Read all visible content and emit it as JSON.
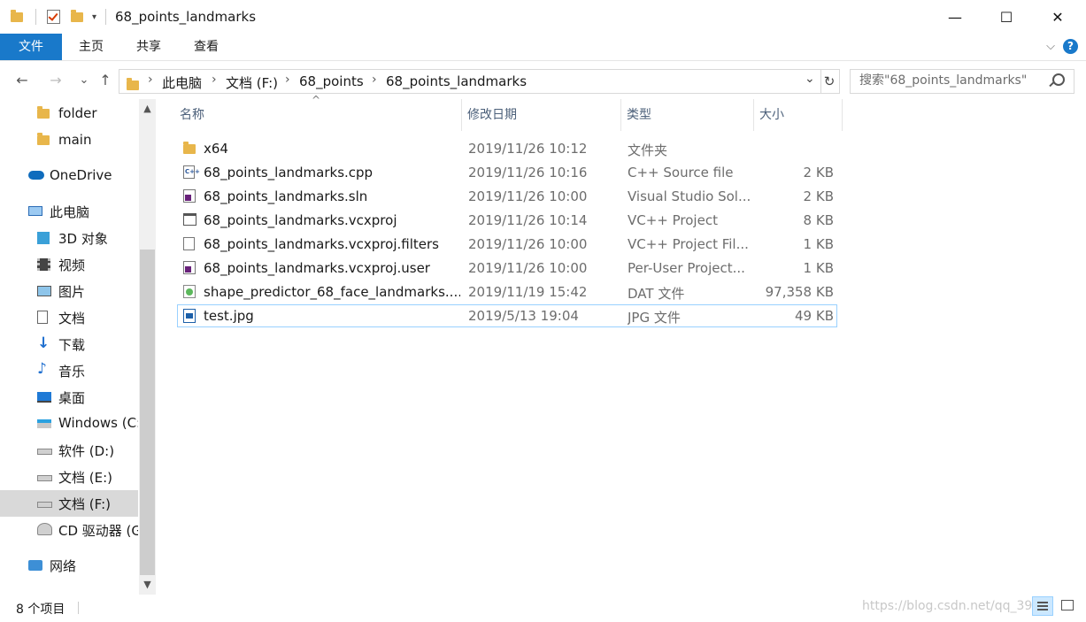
{
  "window": {
    "title": "68_points_landmarks",
    "minimize_glyph": "—",
    "maximize_glyph": "☐",
    "close_glyph": "✕"
  },
  "ribbon": {
    "tabs": [
      "文件",
      "主页",
      "共享",
      "查看"
    ],
    "expand_glyph": "⌵",
    "help_glyph": "?"
  },
  "nav": {
    "back_glyph": "←",
    "forward_glyph": "→",
    "recent_glyph": "⌄",
    "up_glyph": "↑",
    "breadcrumbs": [
      "此电脑",
      "文档 (F:)",
      "68_points",
      "68_points_landmarks"
    ],
    "crumb_separator": "›",
    "dropdown_glyph": "⌄",
    "refresh_glyph": "↻"
  },
  "search": {
    "placeholder": "搜索\"68_points_landmarks\""
  },
  "sidebar": {
    "items": [
      {
        "label": "folder",
        "icon": "folder-icon"
      },
      {
        "label": "main",
        "icon": "folder-icon"
      },
      {
        "label": "OneDrive",
        "icon": "cloud-icon"
      },
      {
        "label": "此电脑",
        "icon": "computer-icon"
      },
      {
        "label": "3D 对象",
        "icon": "cube-icon"
      },
      {
        "label": "视频",
        "icon": "video-icon"
      },
      {
        "label": "图片",
        "icon": "picture-icon"
      },
      {
        "label": "文档",
        "icon": "document-icon"
      },
      {
        "label": "下载",
        "icon": "download-icon"
      },
      {
        "label": "音乐",
        "icon": "music-icon"
      },
      {
        "label": "桌面",
        "icon": "desktop-icon"
      },
      {
        "label": "Windows (C:",
        "icon": "windows-drive-icon"
      },
      {
        "label": "软件 (D:)",
        "icon": "drive-icon"
      },
      {
        "label": "文档 (E:)",
        "icon": "drive-icon"
      },
      {
        "label": "文档 (F:)",
        "icon": "drive-icon"
      },
      {
        "label": "CD 驱动器 (G",
        "icon": "cd-drive-icon"
      },
      {
        "label": "网络",
        "icon": "network-icon"
      }
    ],
    "scroll_up_glyph": "▲",
    "scroll_down_glyph": "▼"
  },
  "columns": {
    "name": "名称",
    "date": "修改日期",
    "type": "类型",
    "size": "大小",
    "sort_glyph": "^"
  },
  "files": [
    {
      "name": "x64",
      "date": "2019/11/26 10:12",
      "type": "文件夹",
      "size": "",
      "icon": "folder-icon"
    },
    {
      "name": "68_points_landmarks.cpp",
      "date": "2019/11/26 10:16",
      "type": "C++ Source file",
      "size": "2 KB",
      "icon": "cpp-file-icon"
    },
    {
      "name": "68_points_landmarks.sln",
      "date": "2019/11/26 10:00",
      "type": "Visual Studio Sol...",
      "size": "2 KB",
      "icon": "vs-solution-icon"
    },
    {
      "name": "68_points_landmarks.vcxproj",
      "date": "2019/11/26 10:14",
      "type": "VC++ Project",
      "size": "8 KB",
      "icon": "vcxproj-icon"
    },
    {
      "name": "68_points_landmarks.vcxproj.filters",
      "date": "2019/11/26 10:00",
      "type": "VC++ Project Fil...",
      "size": "1 KB",
      "icon": "filters-file-icon"
    },
    {
      "name": "68_points_landmarks.vcxproj.user",
      "date": "2019/11/26 10:00",
      "type": "Per-User Project...",
      "size": "1 KB",
      "icon": "user-file-icon"
    },
    {
      "name": "shape_predictor_68_face_landmarks....",
      "date": "2019/11/19 15:42",
      "type": "DAT 文件",
      "size": "97,358 KB",
      "icon": "dat-file-icon"
    },
    {
      "name": "test.jpg",
      "date": "2019/5/13 19:04",
      "type": "JPG 文件",
      "size": "49 KB",
      "icon": "jpg-file-icon"
    }
  ],
  "status": {
    "item_count": "8 个项目",
    "watermark": "https://blog.csdn.net/qq_39"
  },
  "colors": {
    "accent": "#1979ca",
    "selection": "#cce8ff",
    "focus_border": "#99d1ff"
  }
}
